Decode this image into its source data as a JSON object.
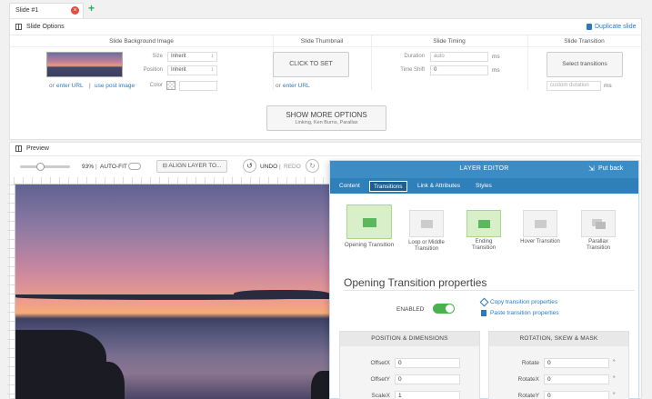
{
  "tabs": {
    "slide_tab": "Slide #1",
    "add": "+"
  },
  "slide_options": {
    "title": "Slide Options",
    "duplicate": "Duplicate slide",
    "columns": {
      "background": "Slide Background Image",
      "thumbnail": "Slide Thumbnail",
      "timing": "Slide Timing",
      "transition": "Slide Transition"
    },
    "background": {
      "size_label": "Size",
      "size_value": "Inherit",
      "position_label": "Position",
      "position_value": "Inherit",
      "color_label": "Color",
      "or": "or",
      "enter_url": "enter URL",
      "sep": "|",
      "use_post_image": "use post image"
    },
    "thumbnail": {
      "button": "CLICK TO SET",
      "or": "or",
      "enter_url": "enter URL"
    },
    "timing": {
      "duration_label": "Duration",
      "duration_value": "auto",
      "duration_unit": "ms",
      "timeshift_label": "Time Shift",
      "timeshift_value": "0",
      "timeshift_unit": "ms"
    },
    "transition": {
      "button": "Select transitions",
      "custom_placeholder": "custom duration",
      "custom_unit": "ms"
    },
    "show_more": {
      "label": "SHOW MORE OPTIONS",
      "sub": "Linking, Ken Burns, Parallax"
    }
  },
  "preview": {
    "title": "Preview",
    "zoom": "93%",
    "autofit": "AUTO-FIT",
    "align": "ALIGN LAYER TO...",
    "undo": "UNDO",
    "redo": "REDO"
  },
  "editor": {
    "title": "LAYER EDITOR",
    "put_back": "Put back",
    "tabs": [
      "Content",
      "Transitions",
      "Link & Attributes",
      "Styles"
    ],
    "active_tab": "Transitions",
    "transitions": [
      {
        "label": "Opening Transition"
      },
      {
        "label": "Loop or Middle Transition"
      },
      {
        "label": "Ending Transition"
      },
      {
        "label": "Hover Transition"
      },
      {
        "label": "Parallax Transition"
      }
    ],
    "section_title": "Opening Transition properties",
    "enabled_label": "ENABLED",
    "copy": "Copy transition properties",
    "paste": "Paste transition properties",
    "position_box": {
      "title": "POSITION & DIMENSIONS",
      "rows": [
        {
          "label": "OffsetX",
          "value": "0"
        },
        {
          "label": "OffsetY",
          "value": "0"
        },
        {
          "label": "ScaleX",
          "value": "1"
        }
      ]
    },
    "rotation_box": {
      "title": "ROTATION, SKEW & MASK",
      "rows": [
        {
          "label": "Rotate",
          "value": "0",
          "unit": "°"
        },
        {
          "label": "RotateX",
          "value": "0",
          "unit": "°"
        },
        {
          "label": "RotateY",
          "value": "0",
          "unit": "°"
        }
      ]
    }
  },
  "colors": {
    "accent": "#3c8dc5",
    "link": "#2a7ac0",
    "enabled": "#4caf50",
    "close": "#e74c3c"
  }
}
